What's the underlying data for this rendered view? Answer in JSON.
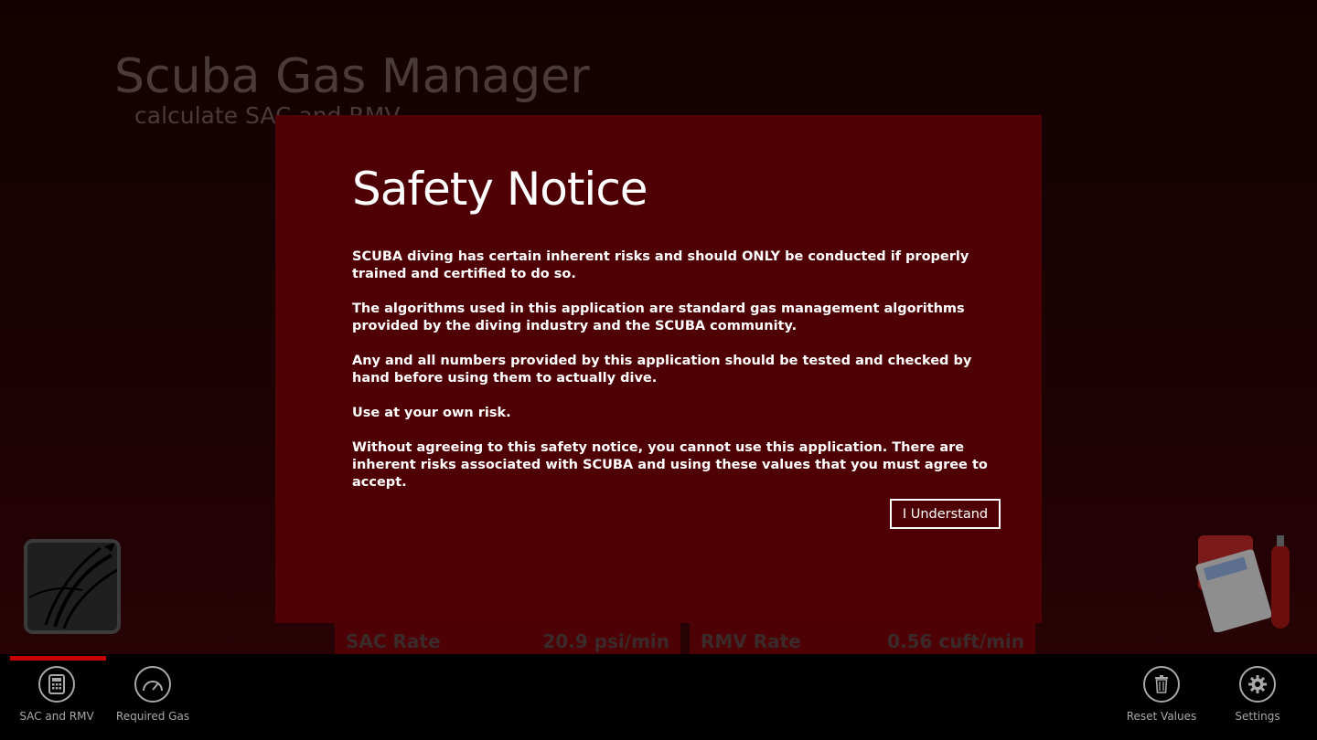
{
  "app": {
    "title": "Scuba Gas Manager",
    "subtitle": "calculate SAC and RMV"
  },
  "results": {
    "sac_label": "SAC Rate",
    "sac_value": "20.9 psi/min",
    "rmv_label": "RMV Rate",
    "rmv_value": "0.56 cuft/min"
  },
  "dialog": {
    "title": "Safety Notice",
    "paragraphs": [
      "SCUBA diving has certain inherent risks and should ONLY be conducted if properly trained and certified to do so.",
      "The algorithms used in this application are standard gas management algorithms provided by the diving industry and the SCUBA community.",
      "Any and all numbers provided by this application should be tested and checked by hand before using them to actually dive.",
      "Use at your own risk.",
      "Without agreeing to this safety notice, you cannot use this application. There are inherent risks associated with SCUBA and using these values that you must agree to accept."
    ],
    "button_label": "I Understand"
  },
  "app_bar": {
    "buttons": [
      {
        "label": "SAC and RMV",
        "icon": "calculator-icon"
      },
      {
        "label": "Required Gas",
        "icon": "gauge-icon"
      },
      {
        "label": "Reset Values",
        "icon": "trash-icon"
      },
      {
        "label": "Settings",
        "icon": "gear-icon"
      }
    ]
  },
  "colors": {
    "dialog_bg": "#4f0004",
    "indicator": "#c70000",
    "tile_bg": "#4e0105"
  }
}
